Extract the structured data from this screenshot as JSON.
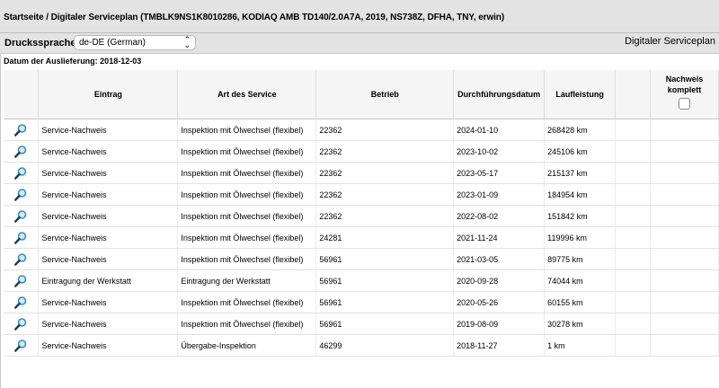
{
  "header": {
    "breadcrumb": "Startseite / Digitaler Serviceplan (TMBLK9NS1K8010286, KODIAQ AMB TD140/2.0A7A, 2019, NS738Z, DFHA, TNY, erwin)"
  },
  "toolbar": {
    "print_language_label": "Druckssprache:",
    "print_language_value": "de-DE (German)",
    "page_heading": "Digitaler Serviceplan"
  },
  "delivery_date": "Datum der Auslieferung: 2018-12-03",
  "table": {
    "columns": {
      "entry": "Eintrag",
      "service_type": "Art des Service",
      "workshop": "Betrieb",
      "date": "Durchführungsdatum",
      "mileage": "Laufleistung",
      "proof_complete_line1": "Nachweis",
      "proof_complete_line2": "komplett"
    },
    "rows": [
      {
        "entry": "Service-Nachweis",
        "service_type": "Inspektion mit Ölwechsel (flexibel)",
        "workshop": "22362",
        "date": "2024-01-10",
        "mileage": "268428 km"
      },
      {
        "entry": "Service-Nachweis",
        "service_type": "Inspektion mit Ölwechsel (flexibel)",
        "workshop": "22362",
        "date": "2023-10-02",
        "mileage": "245106 km"
      },
      {
        "entry": "Service-Nachweis",
        "service_type": "Inspektion mit Ölwechsel (flexibel)",
        "workshop": "22362",
        "date": "2023-05-17",
        "mileage": "215137 km"
      },
      {
        "entry": "Service-Nachweis",
        "service_type": "Inspektion mit Ölwechsel (flexibel)",
        "workshop": "22362",
        "date": "2023-01-09",
        "mileage": "184954 km"
      },
      {
        "entry": "Service-Nachweis",
        "service_type": "Inspektion mit Ölwechsel (flexibel)",
        "workshop": "22362",
        "date": "2022-08-02",
        "mileage": "151842 km"
      },
      {
        "entry": "Service-Nachweis",
        "service_type": "Inspektion mit Ölwechsel (flexibel)",
        "workshop": "24281",
        "date": "2021-11-24",
        "mileage": "119996 km"
      },
      {
        "entry": "Service-Nachweis",
        "service_type": "Inspektion mit Ölwechsel (flexibel)",
        "workshop": "56961",
        "date": "2021-03-05",
        "mileage": "89775 km"
      },
      {
        "entry": "Eintragung der Werkstatt",
        "service_type": "Eintragung der Werkstatt",
        "workshop": "56961",
        "date": "2020-09-28",
        "mileage": "74044 km"
      },
      {
        "entry": "Service-Nachweis",
        "service_type": "Inspektion mit Ölwechsel (flexibel)",
        "workshop": "56961",
        "date": "2020-05-26",
        "mileage": "60155 km"
      },
      {
        "entry": "Service-Nachweis",
        "service_type": "Inspektion mit Ölwechsel (flexibel)",
        "workshop": "56961",
        "date": "2019-08-09",
        "mileage": "30278 km"
      },
      {
        "entry": "Service-Nachweis",
        "service_type": "Übergabe-Inspektion",
        "workshop": "46299",
        "date": "2018-11-27",
        "mileage": "1 km"
      }
    ]
  },
  "icons": {
    "row_detail": "magnifier-icon",
    "language_dropdown": "chevron-updown-icon"
  },
  "colors": {
    "bar_background": "#e3e3e3",
    "header_background": "#f5f5f5",
    "magnifier_lens": "#3a8fb5"
  }
}
